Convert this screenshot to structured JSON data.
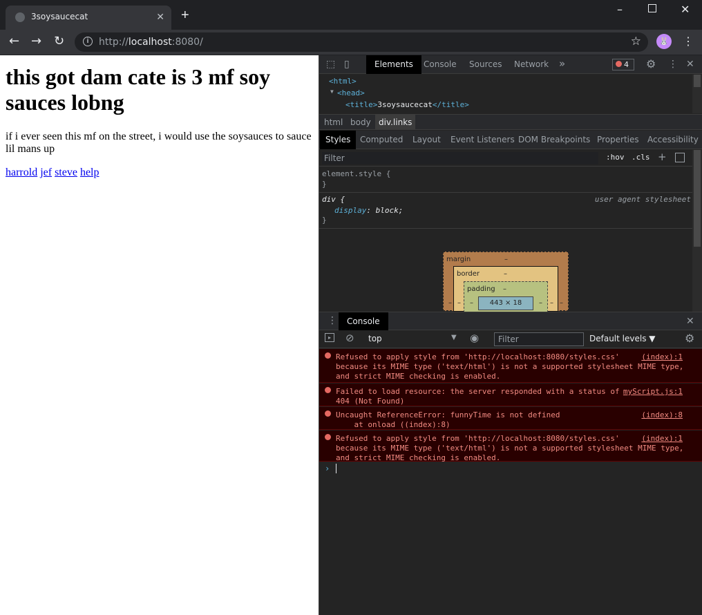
{
  "browser": {
    "tab_title": "3soysaucecat",
    "tab_close": "✕",
    "new_tab": "+",
    "url_host": "http://",
    "url_main": "localhost",
    "url_port": ":8080/",
    "avatar_text": "🐰"
  },
  "page": {
    "heading": "this got dam cate is 3 mf soy sauces lobng",
    "paragraph": "if i ever seen this mf on the street, i would use the soysauces to sauce lil mans up",
    "links": [
      "harrold",
      "jef",
      "steve",
      "help"
    ]
  },
  "devtools": {
    "tabs": [
      "Elements",
      "Console",
      "Sources",
      "Network"
    ],
    "more": "»",
    "error_count": "4",
    "dom_lines": {
      "html": "<html>",
      "head": "<head>",
      "title_open": "<title>",
      "title_text": "3soysaucecat",
      "title_close": "</title>"
    },
    "breadcrumbs": [
      "html",
      "body",
      "div.links"
    ],
    "subtabs": [
      "Styles",
      "Computed",
      "Layout",
      "Event Listeners",
      "DOM Breakpoints",
      "Properties",
      "Accessibility"
    ],
    "filter_placeholder": "Filter",
    "hov": ":hov",
    "cls": ".cls",
    "element_style": "element.style {",
    "close_brace": "}",
    "ua_selector": "div {",
    "ua_source": "user agent stylesheet",
    "ua_prop": "display",
    "ua_value": "block;",
    "box": {
      "margin_label": "margin",
      "border_label": "border",
      "padding_label": "padding",
      "dash": "–",
      "content_size": "443 × 18"
    },
    "drawer_tab": "Console",
    "context": "top",
    "console_filter_placeholder": "Filter",
    "levels": "Default levels ▼",
    "messages": [
      {
        "lines": [
          "Refused to apply style from 'http://localhost:8080/styles.css'",
          "because its MIME type ('text/html') is not a supported stylesheet MIME type,",
          "and strict MIME checking is enabled."
        ],
        "source": "(index):1"
      },
      {
        "lines": [
          "Failed to load resource: the server responded with a status of",
          "404 (Not Found)"
        ],
        "source": "myScript.js:1"
      },
      {
        "lines": [
          "Uncaught ReferenceError: funnyTime is not defined",
          "    at onload ((index):8)"
        ],
        "source": "(index):8"
      },
      {
        "lines": [
          "Refused to apply style from 'http://localhost:8080/styles.css'",
          "because its MIME type ('text/html') is not a supported stylesheet MIME type,",
          "and strict MIME checking is enabled."
        ],
        "source": "(index):1"
      }
    ],
    "prompt": "›"
  },
  "colors": {
    "link": "#0000ee",
    "error_bg": "#290000",
    "error_text": "#f28b82",
    "tag": "#5db0d7"
  }
}
